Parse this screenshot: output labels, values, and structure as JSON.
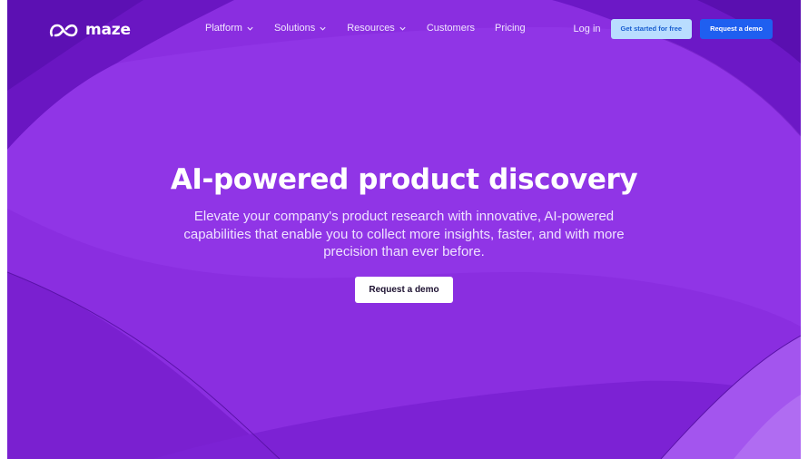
{
  "brand": {
    "name": "maze",
    "logo_icon": "maze-logo-icon"
  },
  "nav": {
    "items": [
      {
        "label": "Platform",
        "has_dropdown": true
      },
      {
        "label": "Solutions",
        "has_dropdown": true
      },
      {
        "label": "Resources",
        "has_dropdown": true
      },
      {
        "label": "Customers",
        "has_dropdown": false
      },
      {
        "label": "Pricing",
        "has_dropdown": false
      }
    ],
    "login_label": "Log in",
    "get_started_label": "Get started for free",
    "request_demo_label": "Request a demo"
  },
  "hero": {
    "title": "AI-powered product discovery",
    "subtitle": "Elevate your company's product research with innovative, AI-powered capabilities that enable you to collect more insights, faster, and with more precision than ever before.",
    "cta_label": "Request a demo"
  },
  "colors": {
    "background": "#8a2be2",
    "get_started_bg": "#b9ddff",
    "get_started_text": "#1a5fd0",
    "request_demo_bg": "#1f5ff0",
    "cta_bg": "#ffffff"
  }
}
